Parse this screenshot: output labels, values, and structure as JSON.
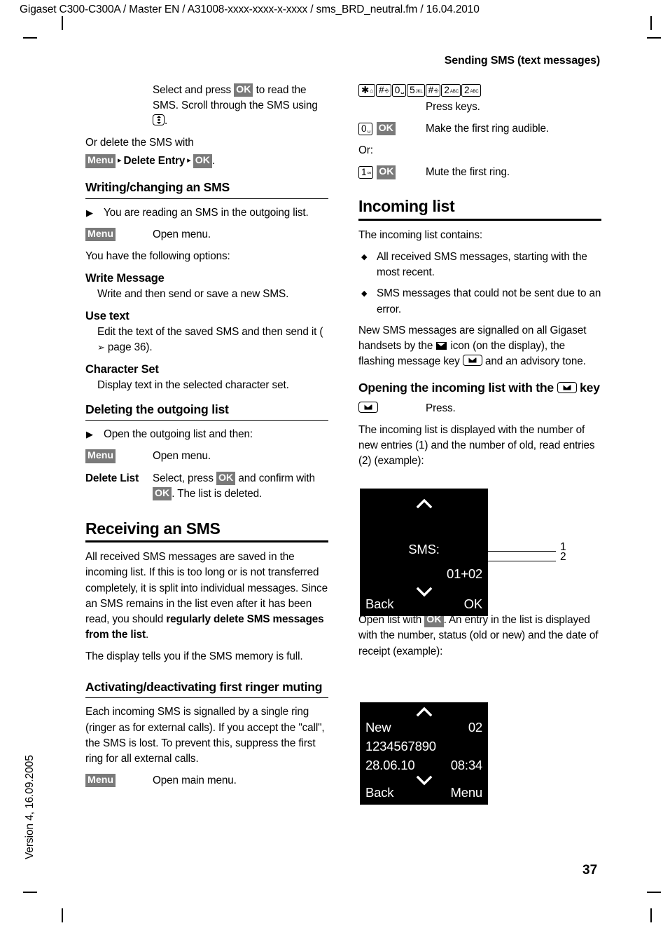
{
  "header": {
    "doc_line": "Gigaset C300-C300A / Master EN / A31008-xxxx-xxxx-x-xxxx / sms_BRD_neutral.fm / 16.04.2010",
    "section_title": "Sending SMS (text messages)"
  },
  "spine": {
    "version": "Version 4, 16.09.2005"
  },
  "footer": {
    "page_number": "37"
  },
  "softkeys": {
    "menu": "Menu",
    "ok": "OK"
  },
  "left_column": {
    "intro": {
      "text_a": "Select and press ",
      "text_b": " to read the SMS. Scroll through the SMS using ",
      "text_c": "."
    },
    "delete_sms": {
      "lead": "Or delete the SMS with",
      "path_item": "Delete Entry",
      "trail": "."
    },
    "writing_heading": "Writing/changing an SMS",
    "writing_step": "You are reading an SMS in the outgoing list.",
    "open_menu_label": "Open menu.",
    "options_lead": "You have the following options:",
    "options": [
      {
        "title": "Write Message",
        "body": "Write and then send or save a new SMS."
      },
      {
        "title": "Use text",
        "body_a": "Edit the text of the saved SMS and then send it (",
        "body_ref": " page 36).",
        "body_b": ""
      },
      {
        "title": "Character Set",
        "body": "Display text in the selected character set."
      }
    ],
    "deleting_heading": "Deleting the outgoing list",
    "deleting_step": "Open the outgoing list and then:",
    "deleting_menu_label": "Open menu.",
    "delete_list_key": "Delete List",
    "delete_list_val_a": "Select, press ",
    "delete_list_val_b": " and confirm with ",
    "delete_list_val_c": ". The list is deleted.",
    "receiving_heading": "Receiving an SMS",
    "receiving_body_a": "All received SMS messages are saved in the incoming list. If this is too long or is not transferred completely, it is split into individual messages. Since an SMS remains in the list even after it has been read, you should ",
    "receiving_body_bold": "regularly delete SMS messages from the list",
    "receiving_body_c": ".",
    "receiving_body_2": "The display tells you if the SMS memory is full.",
    "ringer_heading": "Activating/deactivating first ringer muting",
    "ringer_body": "Each incoming SMS is signalled by a single ring (ringer as for external calls). If you accept the \"call\", the SMS is lost. To prevent this, suppress the first ring for all external calls.",
    "ringer_menu_label": "Open main menu."
  },
  "right_column": {
    "key_sequence": [
      {
        "main": "✱",
        "sub": "⌂",
        "sub_kind": "glyph"
      },
      {
        "main": "#",
        "sub": "⎆",
        "sub_kind": "glyph"
      },
      {
        "main": "0",
        "sub": "␣",
        "sub_kind": "glyph"
      },
      {
        "main": "5",
        "sub": "JKL",
        "sub_kind": "text"
      },
      {
        "main": "#",
        "sub": "⎆",
        "sub_kind": "glyph"
      },
      {
        "main": "2",
        "sub": "ABC",
        "sub_kind": "text"
      },
      {
        "main": "2",
        "sub": "ABC",
        "sub_kind": "text"
      }
    ],
    "press_keys_label": "Press keys.",
    "audible_key": {
      "main": "0",
      "sub": "␣",
      "sub_kind": "glyph"
    },
    "audible_label": "Make the first ring audible.",
    "or_label": "Or:",
    "mute_key": {
      "main": "1",
      "sub": "∞",
      "sub_kind": "glyph"
    },
    "mute_label": "Mute the first ring.",
    "incoming_heading": "Incoming list",
    "incoming_lead": "The incoming list contains:",
    "incoming_bullets": [
      "All received SMS messages, starting with the most recent.",
      "SMS messages that could not be sent due to an error."
    ],
    "signalled_a": "New SMS messages are signalled on all Gigaset handsets by the ",
    "signalled_b": " icon (on the display), the flashing message key ",
    "signalled_c": " and an advisory tone.",
    "opening_heading_a": "Opening the incoming list with the ",
    "opening_heading_b": " key",
    "press_label": "Press.",
    "displayed_with": "The incoming list is displayed with the number of new entries (1) and the number of old, read entries (2) (example):",
    "open_list_a": "Open list with ",
    "open_list_b": ". An entry in the list is displayed with the number, status (old or new) and the date of receipt (example):"
  },
  "display_1": {
    "label": "SMS:",
    "counts": "01+02",
    "softkey_left": "Back",
    "softkey_right": "OK",
    "callouts": [
      {
        "num": "1"
      },
      {
        "num": "2"
      }
    ]
  },
  "display_2": {
    "status": "New",
    "count": "02",
    "number": "1234567890",
    "date": "28.06.10",
    "time": "08:34",
    "softkey_left": "Back",
    "softkey_right": "Menu"
  },
  "colors": {
    "softkey_bg": "#7a7a7a",
    "display_bg": "#000000",
    "display_fg": "#ffffff"
  }
}
